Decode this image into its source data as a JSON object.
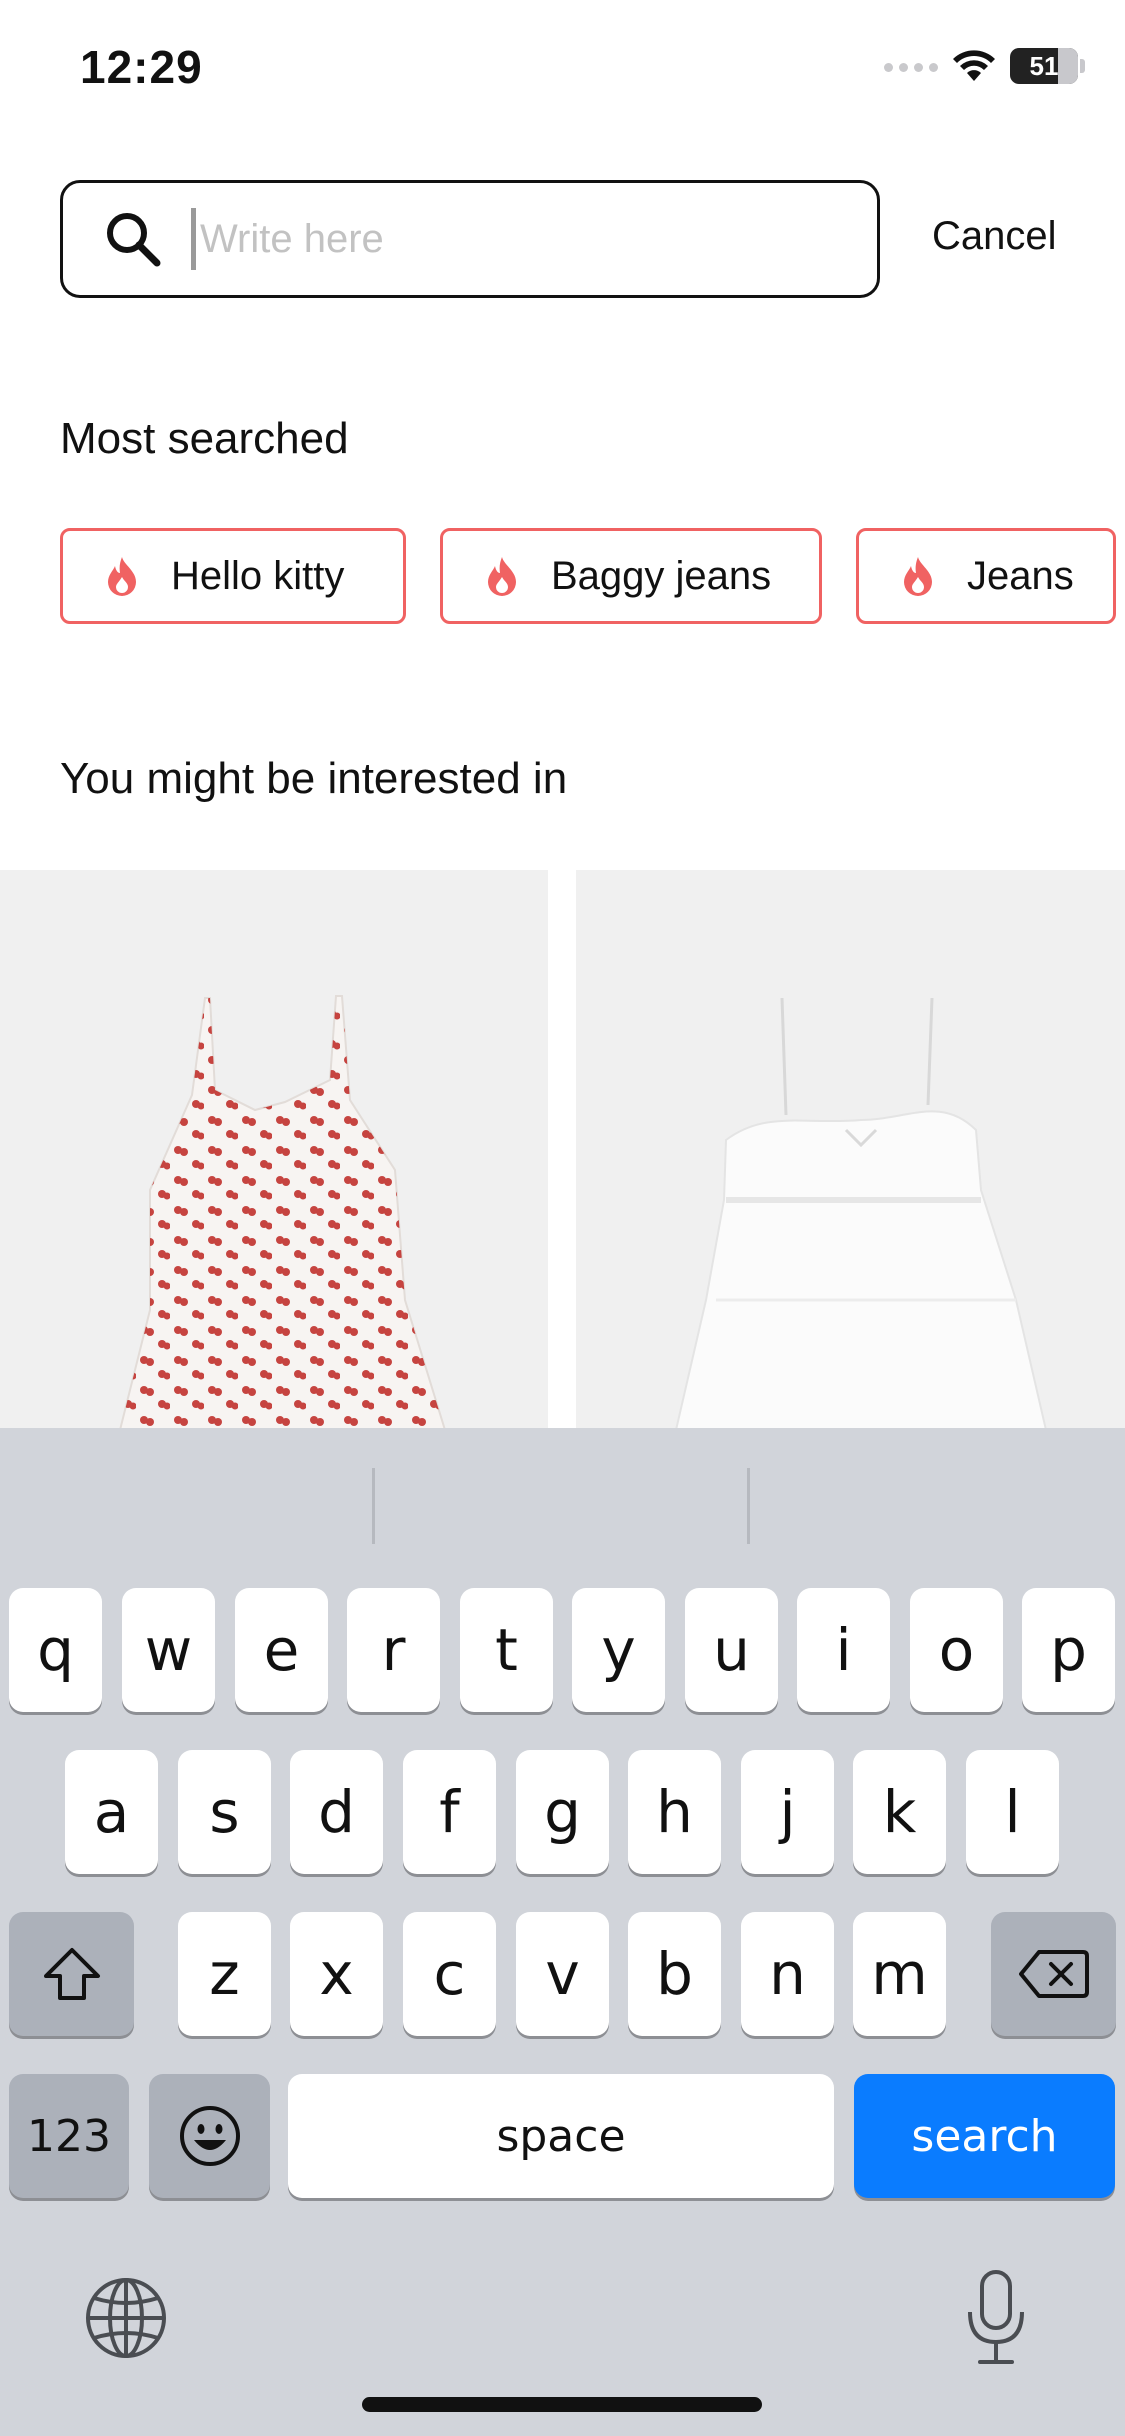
{
  "status_bar": {
    "time": "12:29",
    "battery": "51"
  },
  "search": {
    "placeholder": "Write here",
    "cancel_label": "Cancel"
  },
  "most_searched": {
    "title": "Most searched",
    "chips": [
      {
        "label": "Hello kitty"
      },
      {
        "label": "Baggy jeans"
      },
      {
        "label": "Jeans"
      }
    ]
  },
  "recommendations": {
    "title": "You might be interested in"
  },
  "keyboard": {
    "row1": [
      "q",
      "w",
      "e",
      "r",
      "t",
      "y",
      "u",
      "i",
      "o",
      "p"
    ],
    "row2": [
      "a",
      "s",
      "d",
      "f",
      "g",
      "h",
      "j",
      "k",
      "l"
    ],
    "row3": [
      "z",
      "x",
      "c",
      "v",
      "b",
      "n",
      "m"
    ],
    "numbers_label": "123",
    "space_label": "space",
    "search_label": "search"
  },
  "colors": {
    "accent_red": "#f06262",
    "keyboard_blue": "#0a7cff"
  }
}
